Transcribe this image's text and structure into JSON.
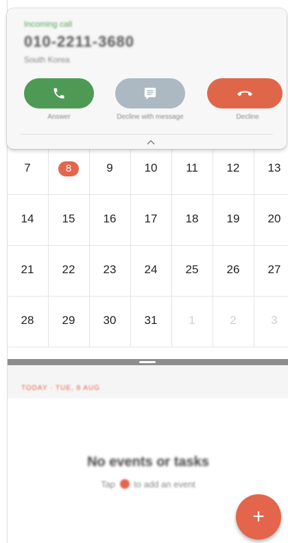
{
  "incoming_call": {
    "label": "Incoming call",
    "number": "010-2211-3680",
    "location": "South Korea",
    "answer_caption": "Answer",
    "message_caption": "Decline with message",
    "decline_caption": "Decline",
    "colors": {
      "answer": "#4e9a55",
      "message": "#adb9c2",
      "decline": "#e0664a"
    }
  },
  "calendar": {
    "rows": [
      [
        "7",
        "8",
        "9",
        "10",
        "11",
        "12",
        "13"
      ],
      [
        "14",
        "15",
        "16",
        "17",
        "18",
        "19",
        "20"
      ],
      [
        "21",
        "22",
        "23",
        "24",
        "25",
        "26",
        "27"
      ],
      [
        "28",
        "29",
        "30",
        "31",
        "1",
        "2",
        "3"
      ]
    ],
    "today": "8",
    "accent": "#e3654b"
  },
  "events": {
    "date_label": "TODAY · TUE, 8 AUG",
    "empty_title": "No events or tasks",
    "hint_before": "Tap",
    "hint_after": "to add an event",
    "fab_label": "+"
  }
}
